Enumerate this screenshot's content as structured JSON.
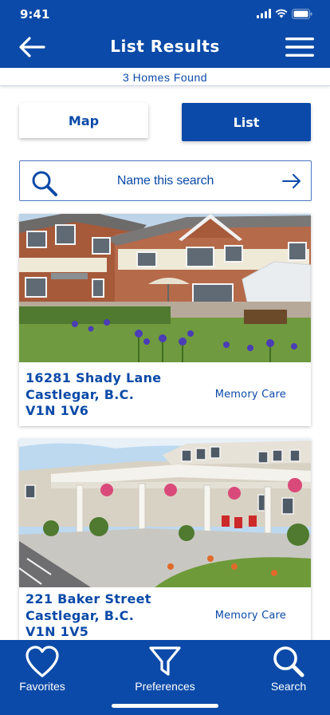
{
  "status": {
    "time": "9:41"
  },
  "header": {
    "title": "List Results"
  },
  "results": {
    "count_label": "3 Homes Found"
  },
  "view_toggle": {
    "map_label": "Map",
    "list_label": "List",
    "selected": "List"
  },
  "search": {
    "label": "Name this search"
  },
  "listings": [
    {
      "street": "16281 Shady Lane",
      "city": "Castlegar, B.C.",
      "postal": "V1N 1V6",
      "care_type": "Memory Care"
    },
    {
      "street": "221 Baker Street",
      "city": "Castlegar, B.C.",
      "postal": "V1N 1V5",
      "care_type": "Memory Care"
    }
  ],
  "tabbar": {
    "favorites": "Favorites",
    "preferences": "Preferences",
    "search": "Search"
  },
  "colors": {
    "brand_blue": "#0b4aa8",
    "background": "#ffffff"
  },
  "icons": [
    "back-arrow-icon",
    "hamburger-menu-icon",
    "search-icon",
    "arrow-right-icon",
    "heart-icon",
    "filter-funnel-icon",
    "signal-icon",
    "wifi-icon",
    "battery-icon"
  ]
}
